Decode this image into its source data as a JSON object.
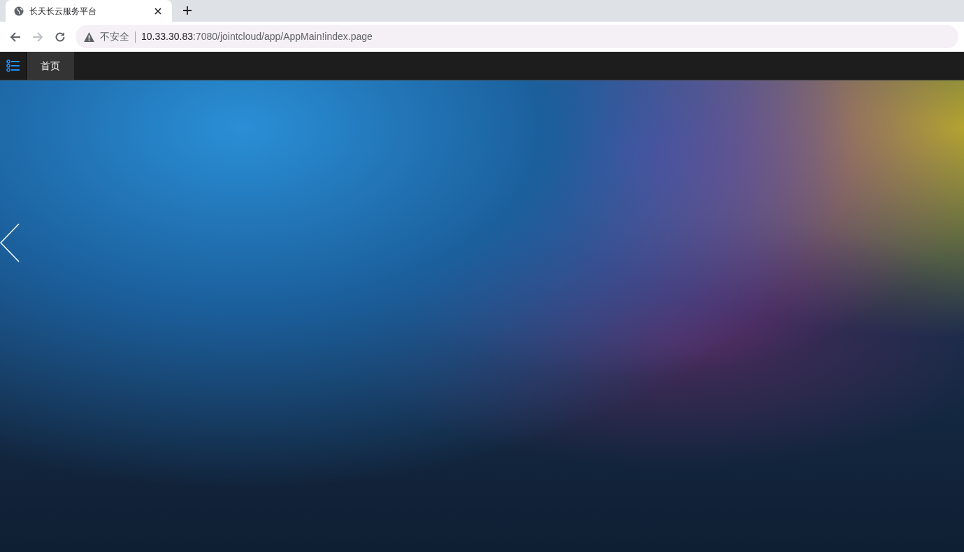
{
  "browser": {
    "tabs": [
      {
        "title": "长天长云服务平台",
        "selected": true
      }
    ],
    "security_label": "不安全",
    "url_host": "10.33.30.83",
    "url_path": ":7080/jointcloud/app/AppMain!index.page"
  },
  "app": {
    "tabs": [
      {
        "label": "首页",
        "selected": true
      }
    ]
  }
}
